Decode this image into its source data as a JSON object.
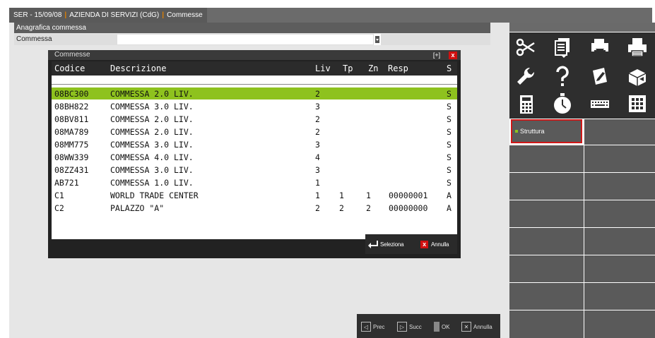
{
  "titlebar": {
    "segments": [
      "SER - 15/09/08",
      "AZIENDA DI SERVIZI (CdG)",
      "Commesse"
    ]
  },
  "form": {
    "section_title": "Anagrafica commessa",
    "field_label": "Commessa",
    "field_value": ""
  },
  "dialog": {
    "title": "Commesse",
    "header_btn_expand": "[+]",
    "header_btn_close": "x",
    "columns": {
      "code": "Codice",
      "desc": "Descrizione",
      "liv": "Liv",
      "tp": "Tp",
      "zn": "Zn",
      "resp": "Resp",
      "s": "S"
    },
    "rows": [
      {
        "code": "08BC300",
        "desc": "COMMESSA 2.0 LIV.",
        "liv": "2",
        "tp": "",
        "zn": "",
        "resp": "",
        "s": "S",
        "selected": true
      },
      {
        "code": "08BH822",
        "desc": "COMMESSA 3.0 LIV.",
        "liv": "3",
        "tp": "",
        "zn": "",
        "resp": "",
        "s": "S"
      },
      {
        "code": "08BV811",
        "desc": "COMMESSA 2.0 LIV.",
        "liv": "2",
        "tp": "",
        "zn": "",
        "resp": "",
        "s": "S"
      },
      {
        "code": "08MA789",
        "desc": "COMMESSA 2.0 LIV.",
        "liv": "2",
        "tp": "",
        "zn": "",
        "resp": "",
        "s": "S"
      },
      {
        "code": "08MM775",
        "desc": "COMMESSA 3.0 LIV.",
        "liv": "3",
        "tp": "",
        "zn": "",
        "resp": "",
        "s": "S"
      },
      {
        "code": "08WW339",
        "desc": "COMMESSA 4.0 LIV.",
        "liv": "4",
        "tp": "",
        "zn": "",
        "resp": "",
        "s": "S"
      },
      {
        "code": "08ZZ431",
        "desc": "COMMESSA 3.0 LIV.",
        "liv": "3",
        "tp": "",
        "zn": "",
        "resp": "",
        "s": "S"
      },
      {
        "code": "AB721",
        "desc": "COMMESSA 1.0 LIV.",
        "liv": "1",
        "tp": "",
        "zn": "",
        "resp": "",
        "s": "S"
      },
      {
        "code": "C1",
        "desc": "WORLD TRADE CENTER",
        "liv": "1",
        "tp": "1",
        "zn": "1",
        "resp": "00000001",
        "s": "A"
      },
      {
        "code": "C2",
        "desc": "PALAZZO \"A\"",
        "liv": "2",
        "tp": "2",
        "zn": "2",
        "resp": "00000000",
        "s": "A"
      }
    ],
    "actions": {
      "select_label": "Seleziona",
      "cancel_label": "Annulla"
    }
  },
  "bottombar": {
    "prev_label": "Prec",
    "next_label": "Succ",
    "ok_label": "OK",
    "cancel_label": "Annulla"
  },
  "rightpanel": {
    "tools": [
      "scissors-icon",
      "documents-icon",
      "printer-preview-icon",
      "printer-icon",
      "wrench-icon",
      "help-icon",
      "edit-icon",
      "box-icon",
      "calculator-icon",
      "stopwatch-icon",
      "keyboard-icon",
      "grid-icon"
    ],
    "struttura_label": "Struttura"
  },
  "colors": {
    "selection": "#8ec21e",
    "close_red": "#d01010",
    "accent_orange": "#e08000"
  }
}
